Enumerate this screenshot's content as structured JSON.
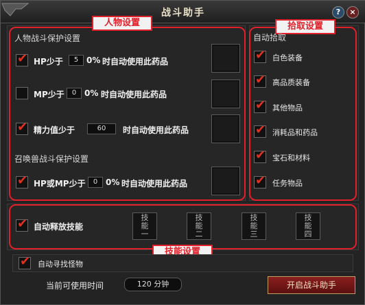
{
  "window": {
    "title": "战斗助手"
  },
  "header": {
    "help_icon": "question-icon",
    "close_icon": "close-icon"
  },
  "annotations": {
    "character": "人物设置",
    "pickup": "拾取设置",
    "skills": "技能设置"
  },
  "character": {
    "section_title": "人物战斗保护设置",
    "rows": [
      {
        "checked": true,
        "prefix": "HP少于",
        "value": "5",
        "suffix": "0%",
        "action": "时自动使用此药品"
      },
      {
        "checked": false,
        "prefix": "MP少于",
        "value": "0",
        "suffix": "0%",
        "action": "时自动使用此药品"
      },
      {
        "checked": true,
        "prefix": "精力值少于",
        "value": "60",
        "suffix": "",
        "action": "时自动使用此药品"
      }
    ],
    "pet_section_title": "召唤兽战斗保护设置",
    "pet_row": {
      "checked": true,
      "prefix": "HP或MP少于",
      "value": "0",
      "suffix": "0%",
      "action": "时自动使用此药品"
    }
  },
  "pickup": {
    "section_title": "自动拾取",
    "items": [
      {
        "label": "白色装备",
        "checked": true
      },
      {
        "label": "高品质装备",
        "checked": true
      },
      {
        "label": "其他物品",
        "checked": true
      },
      {
        "label": "消耗品和药品",
        "checked": true
      },
      {
        "label": "宝石和材料",
        "checked": true
      },
      {
        "label": "任务物品",
        "checked": true
      }
    ]
  },
  "skills": {
    "auto_label": "自动释放技能",
    "auto_checked": true,
    "slots": [
      {
        "line1": "技",
        "line2": "能",
        "line3": "一"
      },
      {
        "line1": "技",
        "line2": "能",
        "line3": "二"
      },
      {
        "line1": "技",
        "line2": "能",
        "line3": "三"
      },
      {
        "line1": "技",
        "line2": "能",
        "line3": "四"
      }
    ]
  },
  "auto_find": {
    "label": "自动寻找怪物",
    "checked": true
  },
  "footer": {
    "time_label": "当前可使用时间",
    "time_value": "120 分钟",
    "start_button": "开启战斗助手"
  },
  "colors": {
    "annotation_red": "#e0202a",
    "check_red": "#e03020"
  }
}
